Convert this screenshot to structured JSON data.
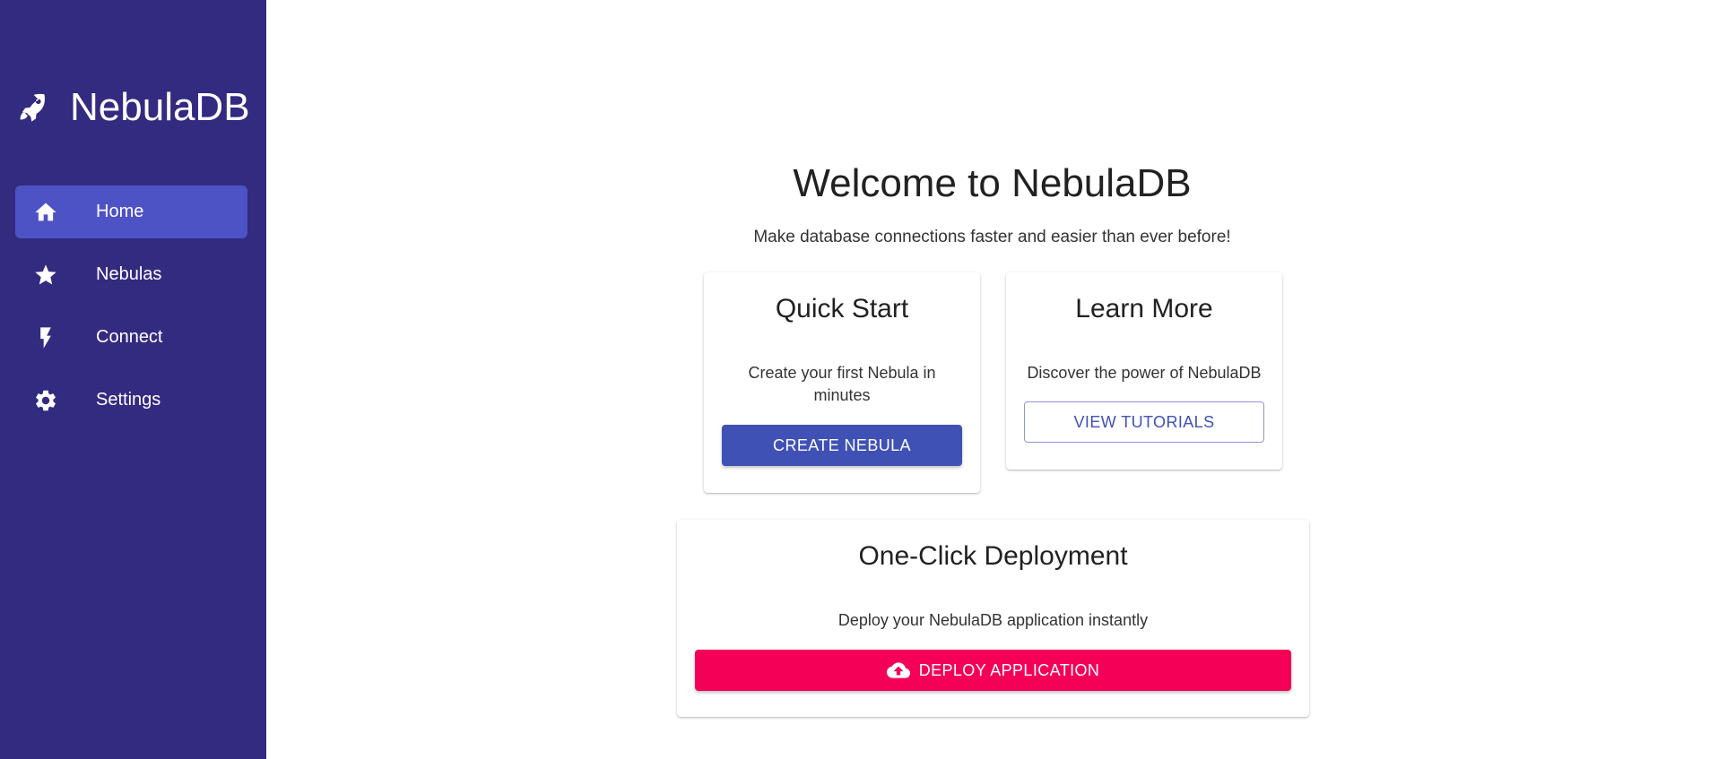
{
  "app": {
    "name": "NebulaDB",
    "logo_icon": "rocket-icon"
  },
  "sidebar": {
    "bg_color": "#332b80",
    "active_color": "#4d52c4",
    "items": [
      {
        "label": "Home",
        "icon": "home-icon",
        "active": true
      },
      {
        "label": "Nebulas",
        "icon": "star-icon",
        "active": false
      },
      {
        "label": "Connect",
        "icon": "bolt-icon",
        "active": false
      },
      {
        "label": "Settings",
        "icon": "gear-icon",
        "active": false
      }
    ]
  },
  "main": {
    "title": "Welcome to NebulaDB",
    "subtitle": "Make database connections faster and easier than ever before!",
    "cards": {
      "quick_start": {
        "title": "Quick Start",
        "text": "Create your first Nebula in minutes",
        "button": "CREATE NEBULA"
      },
      "learn_more": {
        "title": "Learn More",
        "text": "Discover the power of NebulaDB",
        "button": "VIEW TUTORIALS"
      },
      "deploy": {
        "title": "One-Click Deployment",
        "text": "Deploy your NebulaDB application instantly",
        "button": "DEPLOY APPLICATION",
        "button_icon": "cloud-upload-icon"
      }
    }
  },
  "colors": {
    "primary": "#3f51b5",
    "accent": "#f50057"
  }
}
